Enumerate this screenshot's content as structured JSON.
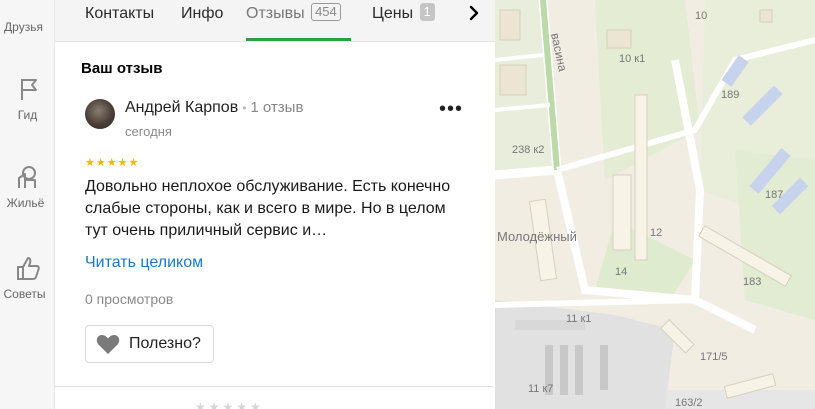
{
  "nav": {
    "items": [
      {
        "label": "Друзья",
        "icon": "friends-icon"
      },
      {
        "label": "Гид",
        "icon": "flag-icon"
      },
      {
        "label": "Жильё",
        "icon": "housing-icon"
      },
      {
        "label": "Советы",
        "icon": "thumbs-up-icon"
      }
    ]
  },
  "tabs": {
    "items": [
      {
        "label": "Контакты"
      },
      {
        "label": "Инфо"
      },
      {
        "label": "Отзывы",
        "count": "454"
      },
      {
        "label": "Цены",
        "count": "1"
      }
    ],
    "active": "Отзывы",
    "next_icon": "chevron-right-icon"
  },
  "review_section": {
    "title": "Ваш отзыв",
    "author": "Андрей Карпов",
    "author_reviews": "1 отзыв",
    "date": "сегодня",
    "rating": 5,
    "stars": "★★★★★",
    "text": "Довольно неплохое обслуживание. Есть конечно слабые стороны, как и всего в мире. Но в целом тут очень приличный сервис и…",
    "read_more": "Читать целиком",
    "views": "0 просмотров",
    "helpful_label": "Полезно?"
  },
  "map": {
    "street": "васина",
    "district": "Молодёжный",
    "building_labels": [
      "10",
      "10 к1",
      "189",
      "187",
      "238 к2",
      "12",
      "14",
      "183",
      "11 к1",
      "171/5",
      "11 к7",
      "163/2"
    ]
  },
  "colors": {
    "accent_green": "#2e9d46",
    "link_blue": "#1a7ac8",
    "star_yellow": "#f2b700"
  }
}
